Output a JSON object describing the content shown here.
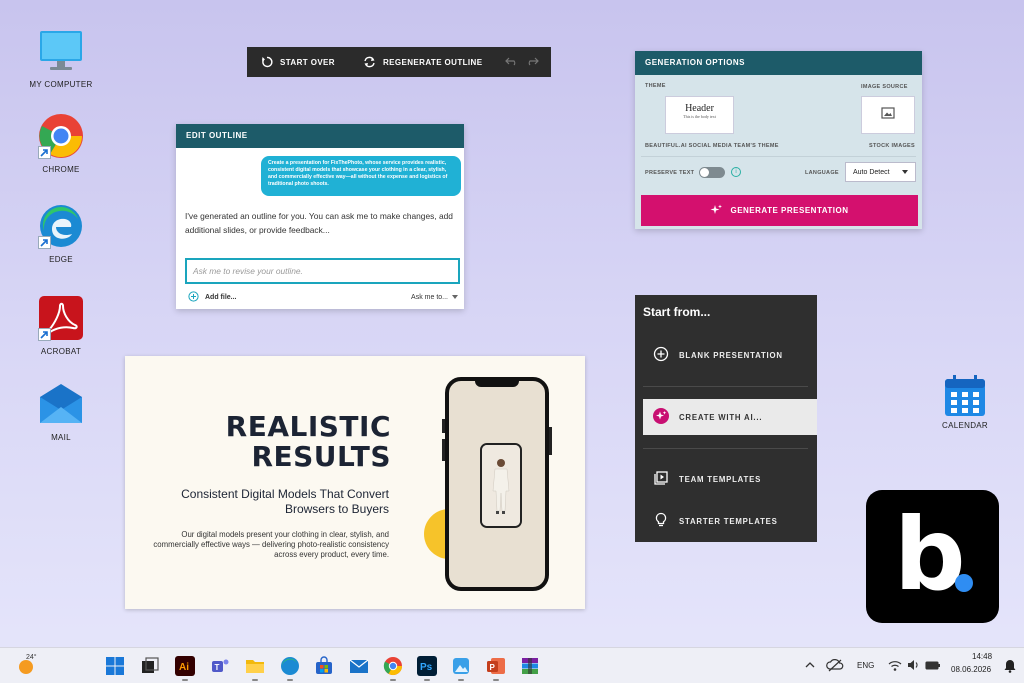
{
  "desktop": {
    "icons": [
      {
        "label": "MY COMPUTER"
      },
      {
        "label": "CHROME"
      },
      {
        "label": "EDGE"
      },
      {
        "label": "ACROBAT"
      },
      {
        "label": "MAIL"
      },
      {
        "label": "CALENDAR"
      }
    ]
  },
  "toolbar": {
    "start_over": "START OVER",
    "regenerate": "REGENERATE OUTLINE"
  },
  "edit_outline": {
    "title": "EDIT OUTLINE",
    "prompt": "Create a presentation for FixThePhoto, whose service provides realistic, consistent digital models that showcase your clothing in a clear, stylish, and commercially effective way—all without the expense and logistics of traditional photo shoots.",
    "reply": "I've generated an outline for you. You can ask me to make changes, add additional slides, or provide feedback...",
    "input_placeholder": "Ask me to revise your outline.",
    "add_file": "Add file...",
    "ask_menu": "Ask me to..."
  },
  "generation_options": {
    "title": "GENERATION OPTIONS",
    "theme_label": "THEME",
    "theme_preview_header": "Header",
    "theme_preview_body": "This is the body text",
    "theme_name": "BEAUTIFUL.AI SOCIAL MEDIA TEAM'S THEME",
    "image_source_label": "IMAGE SOURCE",
    "image_source_value": "STOCK IMAGES",
    "preserve_text_label": "PRESERVE TEXT",
    "preserve_text_on": false,
    "language_label": "LANGUAGE",
    "language_value": "Auto Detect",
    "generate_button": "GENERATE PRESENTATION",
    "accent_color": "#d4106e"
  },
  "slide": {
    "title_line1": "REALISTIC",
    "title_line2": "RESULTS",
    "subtitle": "Consistent Digital Models That Convert Browsers to Buyers",
    "body": "Our digital models present your clothing in clear, stylish, and commercially effective ways — delivering photo-realistic consistency across every product, every time."
  },
  "start_from": {
    "title": "Start from...",
    "items": [
      {
        "label": "BLANK PRESENTATION",
        "icon": "plus-circle-icon"
      },
      {
        "label": "CREATE WITH AI...",
        "icon": "sparkle-icon"
      },
      {
        "label": "TEAM TEMPLATES",
        "icon": "play-stack-icon"
      },
      {
        "label": "STARTER TEMPLATES",
        "icon": "lightbulb-icon"
      }
    ]
  },
  "taskbar": {
    "weather_temp": "24°",
    "language": "ENG",
    "time": "14:48",
    "date": "08.06.2026"
  }
}
